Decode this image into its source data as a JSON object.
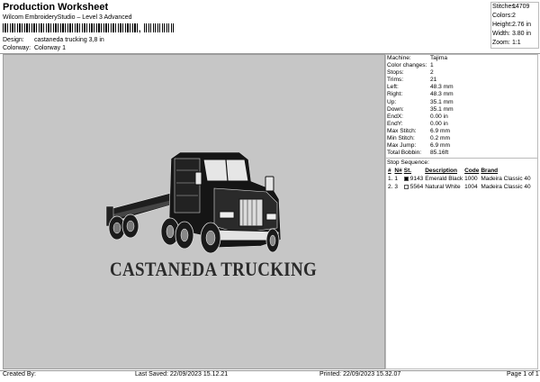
{
  "header": {
    "title": "Production Worksheet",
    "subtitle": "Wilcom EmbroideryStudio – Level 3 Advanced",
    "barcode_mark": ","
  },
  "design_info": {
    "design_label": "Design:",
    "design_value": "castaneda trucking 3,8 in",
    "colorway_label": "Colorway:",
    "colorway_value": "Colorway 1"
  },
  "stats": {
    "stitches_label": "Stitches:",
    "stitches": "14709",
    "colors_label": "Colors:",
    "colors": "2",
    "height_label": "Height:",
    "height": "2.76 in",
    "width_label": "Width:",
    "width": "3.80 in",
    "zoom_label": "Zoom:",
    "zoom": "1:1"
  },
  "design_image": {
    "text": "CASTANEDA TRUCKING",
    "icon": "semi-truck-flatbed-image"
  },
  "machine_info": [
    {
      "label": "Machine:",
      "value": "Tajima"
    },
    {
      "label": "Color changes:",
      "value": "1"
    },
    {
      "label": "Stops:",
      "value": "2"
    },
    {
      "label": "Trims:",
      "value": "21"
    },
    {
      "label": "Left:",
      "value": "48.3 mm"
    },
    {
      "label": "Right:",
      "value": "48.3 mm"
    },
    {
      "label": "Up:",
      "value": "35.1 mm"
    },
    {
      "label": "Down:",
      "value": "35.1 mm"
    },
    {
      "label": "EndX:",
      "value": "0.00 in"
    },
    {
      "label": "EndY:",
      "value": "0.00 in"
    },
    {
      "label": "Max Stitch:",
      "value": "6.9 mm"
    },
    {
      "label": "Min Stitch:",
      "value": "0.2 mm"
    },
    {
      "label": "Max Jump:",
      "value": "6.9 mm"
    },
    {
      "label": "Total Bobbin:",
      "value": "85.16ft"
    }
  ],
  "stop_sequence": {
    "heading": "Stop Sequence:",
    "columns": [
      "#",
      "N#",
      "St.",
      "Description",
      "Code",
      "Brand"
    ],
    "rows": [
      {
        "idx": "1.",
        "n": "1",
        "st": "9143",
        "color": "#000000",
        "description": "Emerald Black",
        "code": "1000",
        "brand": "Madeira Classic 40"
      },
      {
        "idx": "2.",
        "n": "3",
        "st": "5564",
        "color": "#ffffff",
        "description": "Natural White",
        "code": "1004",
        "brand": "Madeira Classic 40"
      }
    ]
  },
  "footer": {
    "created_by": "Created By:",
    "last_saved": "Last Saved: 22/09/2023 15.12.21",
    "printed": "Printed: 22/09/2023 15.32.07",
    "page": "Page 1 of 1"
  }
}
